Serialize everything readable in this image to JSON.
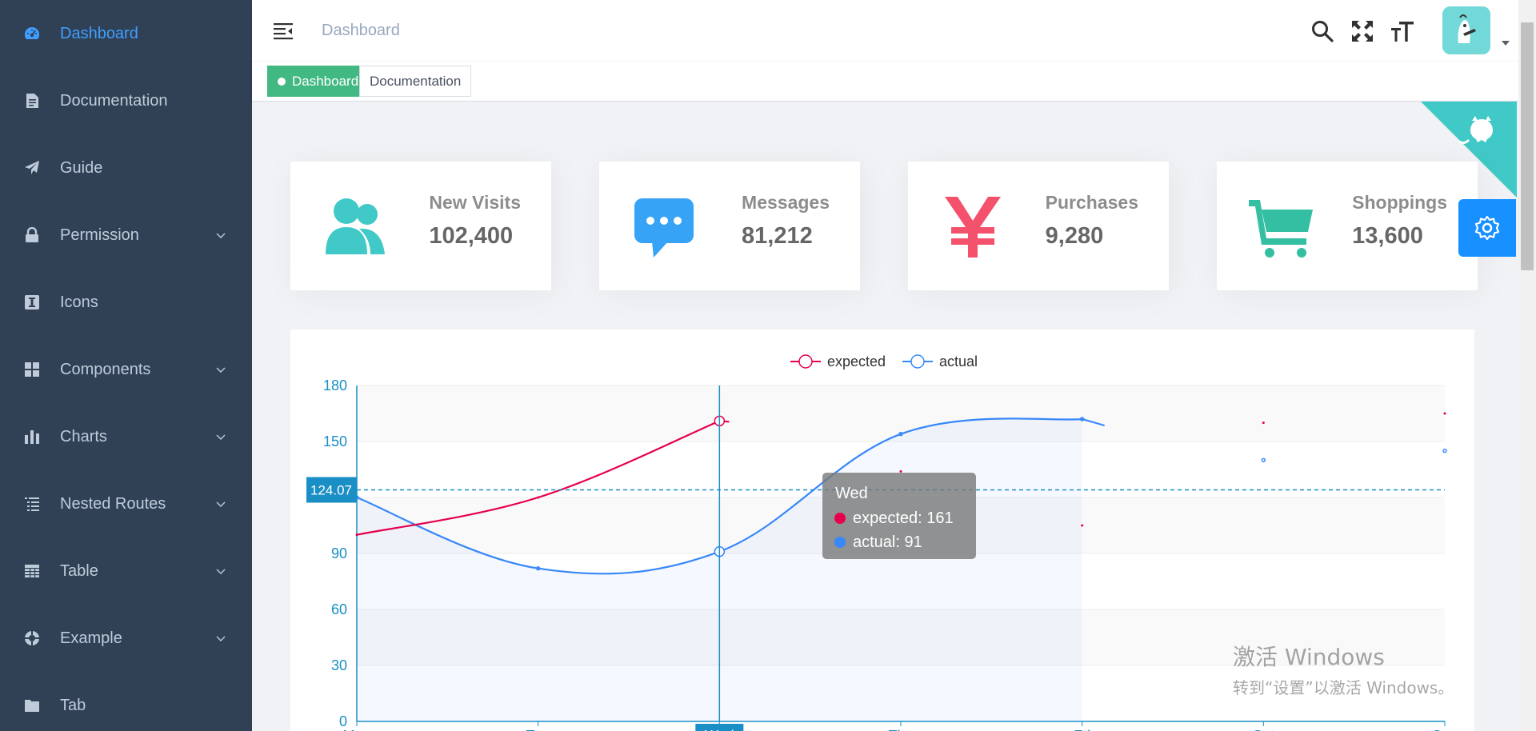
{
  "sidebar": {
    "items": [
      {
        "label": "Dashboard",
        "icon": "dashboard-icon",
        "active": true,
        "has_children": false
      },
      {
        "label": "Documentation",
        "icon": "documentation-icon",
        "active": false,
        "has_children": false
      },
      {
        "label": "Guide",
        "icon": "guide-icon",
        "active": false,
        "has_children": false
      },
      {
        "label": "Permission",
        "icon": "lock-icon",
        "active": false,
        "has_children": true
      },
      {
        "label": "Icons",
        "icon": "icon-icon",
        "active": false,
        "has_children": false
      },
      {
        "label": "Components",
        "icon": "component-icon",
        "active": false,
        "has_children": true
      },
      {
        "label": "Charts",
        "icon": "chart-icon",
        "active": false,
        "has_children": true
      },
      {
        "label": "Nested Routes",
        "icon": "nested-icon",
        "active": false,
        "has_children": true
      },
      {
        "label": "Table",
        "icon": "table-icon",
        "active": false,
        "has_children": true
      },
      {
        "label": "Example",
        "icon": "example-icon",
        "active": false,
        "has_children": true
      },
      {
        "label": "Tab",
        "icon": "tab-icon",
        "active": false,
        "has_children": false
      }
    ]
  },
  "navbar": {
    "breadcrumb": "Dashboard",
    "icons": [
      "search-icon",
      "fullscreen-icon",
      "size-icon"
    ]
  },
  "tags": [
    {
      "label": "Dashboard",
      "active": true
    },
    {
      "label": "Documentation",
      "active": false
    }
  ],
  "cards": [
    {
      "title": "New Visits",
      "value": "102,400",
      "icon": "peoples-icon",
      "color": "#40c9c6"
    },
    {
      "title": "Messages",
      "value": "81,212",
      "icon": "message-icon",
      "color": "#36a3f7"
    },
    {
      "title": "Purchases",
      "value": "9,280",
      "icon": "money-icon",
      "color": "#f4516c"
    },
    {
      "title": "Shoppings",
      "value": "13,600",
      "icon": "shopping-icon",
      "color": "#34bfa3"
    }
  ],
  "colors": {
    "sidebar_bg": "#304156",
    "sidebar_text": "#bfcbd9",
    "active": "#409eff",
    "tag_active": "#42b983",
    "expected": "#e6004c",
    "actual": "#3888fa",
    "axis": "#1a8fc5",
    "settings": "#1890ff"
  },
  "chart_data": {
    "type": "line",
    "legend": [
      "expected",
      "actual"
    ],
    "legend_position": "top-center",
    "categories": [
      "Mon",
      "Tue",
      "Wed",
      "Thu",
      "Fri",
      "Sat",
      "Sun"
    ],
    "y_ticks": [
      "0",
      "30",
      "60",
      "90",
      "120",
      "150",
      "180"
    ],
    "ylim": [
      0,
      180
    ],
    "series": [
      {
        "name": "expected",
        "values": [
          100,
          120,
          161,
          134,
          105,
          160,
          165
        ]
      },
      {
        "name": "actual",
        "values": [
          120,
          82,
          91,
          154,
          162,
          140,
          145
        ]
      }
    ],
    "visible_drawn_until": {
      "expected": 2,
      "actual": 4
    },
    "cursor_line": {
      "value_label": "124.07",
      "y_value": 124.07
    },
    "hovered_category": "Wed",
    "tooltip": {
      "title": "Wed",
      "rows": [
        {
          "label": "expected: 161"
        },
        {
          "label": "actual: 91"
        }
      ]
    }
  },
  "watermark": {
    "line1": "激活 Windows",
    "line2": "转到“设置”以激活 Windows。"
  }
}
